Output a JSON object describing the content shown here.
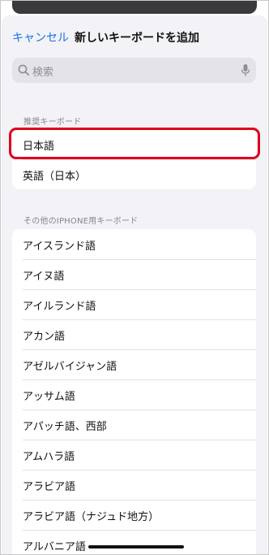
{
  "nav": {
    "cancel_label": "キャンセル",
    "title": "新しいキーボードを追加"
  },
  "search": {
    "placeholder": "検索",
    "icon": "search-icon",
    "mic_icon": "microphone-icon"
  },
  "suggested": {
    "header": "推奨キーボード",
    "items": [
      {
        "label": "日本語",
        "highlighted": true
      },
      {
        "label": "英語（日本）"
      }
    ]
  },
  "other": {
    "header": "その他のIPHONE用キーボード",
    "items": [
      {
        "label": "アイスランド語"
      },
      {
        "label": "アイヌ語"
      },
      {
        "label": "アイルランド語"
      },
      {
        "label": "アカン語"
      },
      {
        "label": "アゼルバイジャン語"
      },
      {
        "label": "アッサム語"
      },
      {
        "label": "アパッチ語、西部"
      },
      {
        "label": "アムハラ語"
      },
      {
        "label": "アラビア語"
      },
      {
        "label": "アラビア語（ナジュド地方）"
      },
      {
        "label": "アルバニア語"
      }
    ]
  },
  "colors": {
    "accent": "#1a73e8",
    "highlight": "#e0001b",
    "background": "#f2f2f7"
  }
}
